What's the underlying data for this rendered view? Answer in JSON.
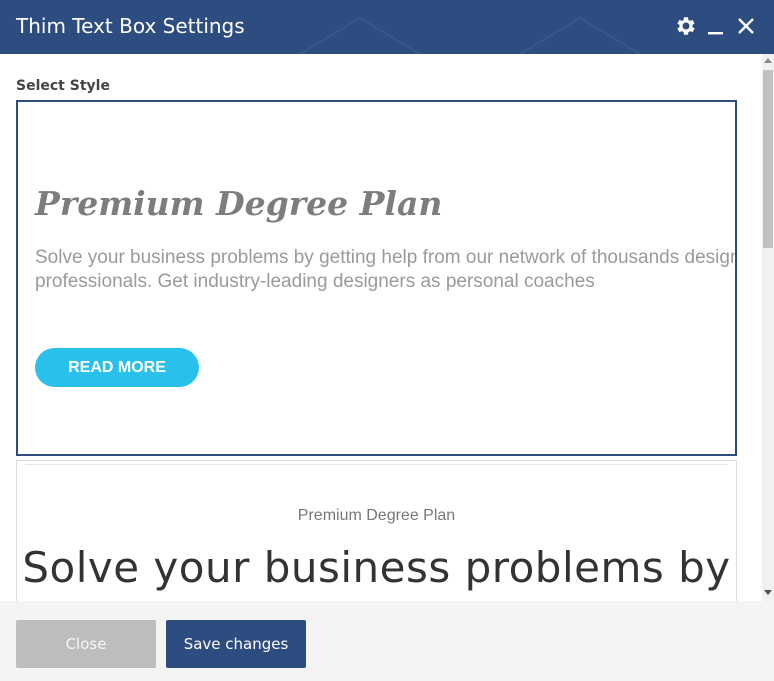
{
  "window": {
    "title": "Thim Text Box Settings",
    "icons": [
      "gear-icon",
      "minimize-icon",
      "close-icon"
    ],
    "header_color": "#2d4c80"
  },
  "form": {
    "select_style_label": "Select Style"
  },
  "style_option_1": {
    "title": "Premium Degree Plan",
    "text": "Solve your business problems by getting help from our network of thousands design professionals. Get industry-leading designers as personal coaches",
    "button_label": "READ MORE",
    "button_color": "#29c1ec",
    "selected": true
  },
  "style_option_2": {
    "subtitle": "Premium Degree Plan",
    "heading": "Solve your business problems by"
  },
  "footer": {
    "close_label": "Close",
    "save_label": "Save changes"
  }
}
